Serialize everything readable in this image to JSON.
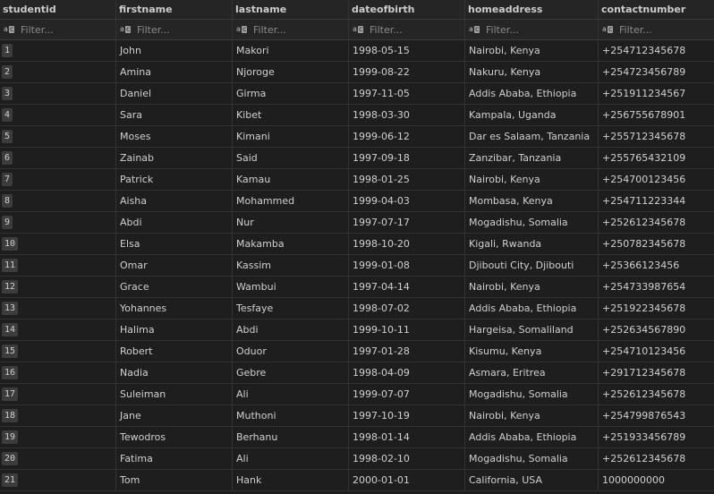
{
  "columns": [
    "studentid",
    "firstname",
    "lastname",
    "dateofbirth",
    "homeaddress",
    "contactnumber"
  ],
  "filter_placeholder": "Filter...",
  "rows": [
    [
      "1",
      "John",
      "Makori",
      "1998-05-15",
      "Nairobi, Kenya",
      "+254712345678"
    ],
    [
      "2",
      "Amina",
      "Njoroge",
      "1999-08-22",
      "Nakuru, Kenya",
      "+254723456789"
    ],
    [
      "3",
      "Daniel",
      "Girma",
      "1997-11-05",
      "Addis Ababa, Ethiopia",
      "+251911234567"
    ],
    [
      "4",
      "Sara",
      "Kibet",
      "1998-03-30",
      "Kampala, Uganda",
      "+256755678901"
    ],
    [
      "5",
      "Moses",
      "Kimani",
      "1999-06-12",
      "Dar es Salaam, Tanzania",
      "+255712345678"
    ],
    [
      "6",
      "Zainab",
      "Said",
      "1997-09-18",
      "Zanzibar, Tanzania",
      "+255765432109"
    ],
    [
      "7",
      "Patrick",
      "Kamau",
      "1998-01-25",
      "Nairobi, Kenya",
      "+254700123456"
    ],
    [
      "8",
      "Aisha",
      "Mohammed",
      "1999-04-03",
      "Mombasa, Kenya",
      "+254711223344"
    ],
    [
      "9",
      "Abdi",
      "Nur",
      "1997-07-17",
      "Mogadishu, Somalia",
      "+252612345678"
    ],
    [
      "10",
      "Elsa",
      "Makamba",
      "1998-10-20",
      "Kigali, Rwanda",
      "+250782345678"
    ],
    [
      "11",
      "Omar",
      "Kassim",
      "1999-01-08",
      "Djibouti City, Djibouti",
      "+25366123456"
    ],
    [
      "12",
      "Grace",
      "Wambui",
      "1997-04-14",
      "Nairobi, Kenya",
      "+254733987654"
    ],
    [
      "13",
      "Yohannes",
      "Tesfaye",
      "1998-07-02",
      "Addis Ababa, Ethiopia",
      "+251922345678"
    ],
    [
      "14",
      "Halima",
      "Abdi",
      "1999-10-11",
      "Hargeisa, Somaliland",
      "+252634567890"
    ],
    [
      "15",
      "Robert",
      "Oduor",
      "1997-01-28",
      "Kisumu, Kenya",
      "+254710123456"
    ],
    [
      "16",
      "Nadia",
      "Gebre",
      "1998-04-09",
      "Asmara, Eritrea",
      "+291712345678"
    ],
    [
      "17",
      "Suleiman",
      "Ali",
      "1999-07-07",
      "Mogadishu, Somalia",
      "+252612345678"
    ],
    [
      "18",
      "Jane",
      "Muthoni",
      "1997-10-19",
      "Nairobi, Kenya",
      "+254799876543"
    ],
    [
      "19",
      "Tewodros",
      "Berhanu",
      "1998-01-14",
      "Addis Ababa, Ethiopia",
      "+251933456789"
    ],
    [
      "20",
      "Fatima",
      "Ali",
      "1998-02-10",
      "Mogadishu, Somalia",
      "+252612345678"
    ],
    [
      "21",
      "Tom",
      "Hank",
      "2000-01-01",
      "California, USA",
      "1000000000"
    ]
  ]
}
